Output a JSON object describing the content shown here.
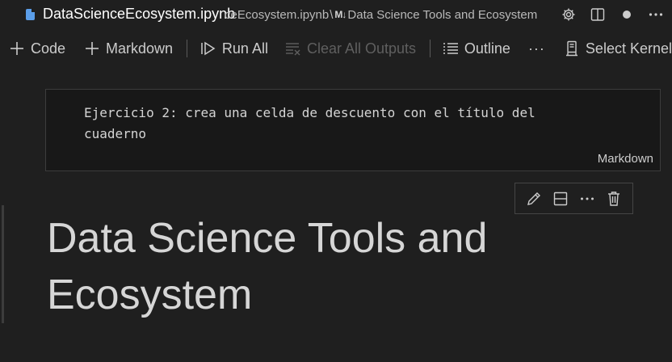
{
  "tab": {
    "title": "DataScienceEcosystem.ipynb",
    "icon": "notebook-file-icon",
    "icon_color": "#5b9ee9"
  },
  "breadcrumb": {
    "file": "ceEcosystem.ipynb",
    "separator": "\\",
    "md_marker": "M↓",
    "section": "Data Science Tools and Ecosystem"
  },
  "title_actions": [
    "gear-icon",
    "split-editor-icon",
    "unsaved-dot-icon",
    "more-icon"
  ],
  "toolbar": {
    "code_label": "Code",
    "markdown_label": "Markdown",
    "run_all_label": "Run All",
    "clear_outputs_label": "Clear All Outputs",
    "outline_label": "Outline",
    "more_label": "···",
    "kernel_label": "Select Kernel"
  },
  "markdown_cell": {
    "source_line1": "Ejercicio 2: crea una celda de descuento con el título del",
    "source_line2": "cuaderno",
    "language": "Markdown"
  },
  "rendered_cell": {
    "heading_line1": "Data Science Tools and",
    "heading_line2": "Ecosystem"
  },
  "cell_toolbar": [
    "edit-pencil-icon",
    "split-cell-icon",
    "more-icon",
    "delete-trash-icon"
  ],
  "colors": {
    "background": "#1f1f1f",
    "cell_background": "#181818",
    "text": "#cccccc",
    "disabled_text": "#5f5f5f"
  }
}
